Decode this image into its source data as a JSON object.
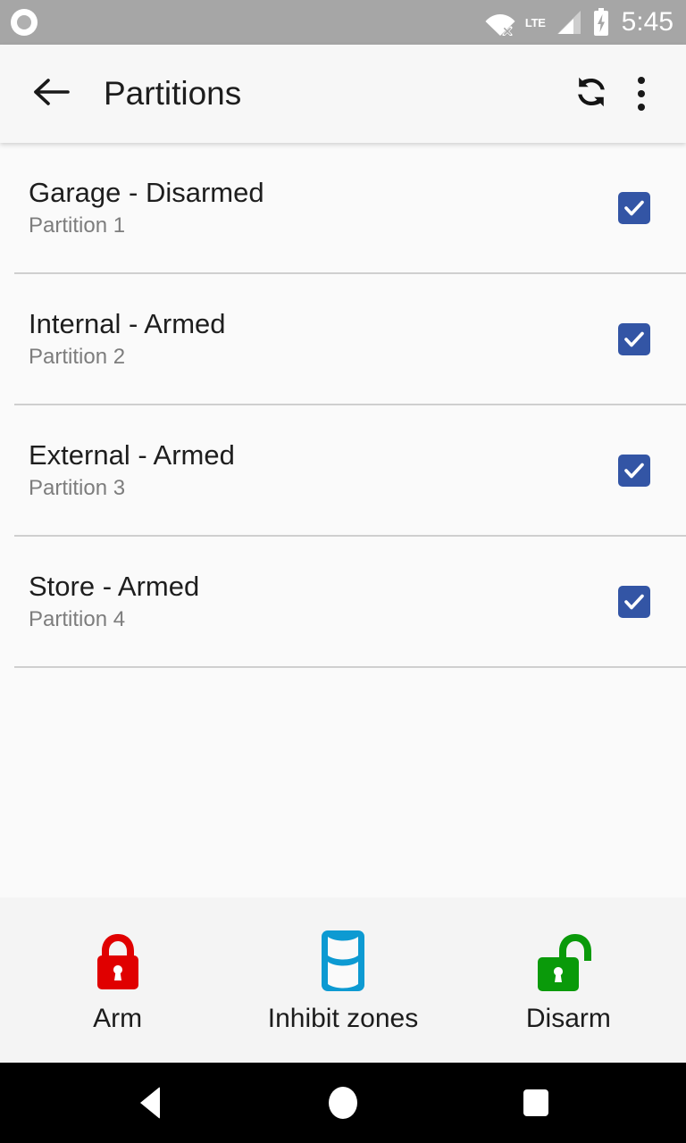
{
  "status_bar": {
    "notification_icon": "circle-notification-icon",
    "wifi_icon": "wifi-off-icon",
    "network_label": "LTE",
    "signal_icon": "cellular-signal-icon",
    "battery_icon": "battery-charging-icon",
    "time": "5:45",
    "background_color": "#a6a6a6"
  },
  "app_bar": {
    "back_icon": "arrow-back-icon",
    "title": "Partitions",
    "refresh_icon": "refresh-sync-icon",
    "overflow_icon": "more-vertical-icon",
    "background_color": "#f7f7f7"
  },
  "partitions": {
    "checkbox_color": "#3355a5",
    "rows": [
      {
        "title": "Garage - Disarmed",
        "subtitle": "Partition 1",
        "checked": true
      },
      {
        "title": "Internal - Armed",
        "subtitle": "Partition 2",
        "checked": true
      },
      {
        "title": "External - Armed",
        "subtitle": "Partition 3",
        "checked": true
      },
      {
        "title": "Store - Armed",
        "subtitle": "Partition 4",
        "checked": true
      }
    ]
  },
  "bottom_bar": {
    "actions": [
      {
        "label": "Arm",
        "icon": "lock-closed-icon",
        "color": "#e00000"
      },
      {
        "label": "Inhibit zones",
        "icon": "zone-cylinder-icon",
        "color": "#0d9ad2"
      },
      {
        "label": "Disarm",
        "icon": "lock-open-icon",
        "color": "#0a9a0a"
      }
    ]
  },
  "nav_bar": {
    "back_icon": "nav-back-triangle-icon",
    "home_icon": "nav-home-circle-icon",
    "recents_icon": "nav-recents-square-icon"
  }
}
